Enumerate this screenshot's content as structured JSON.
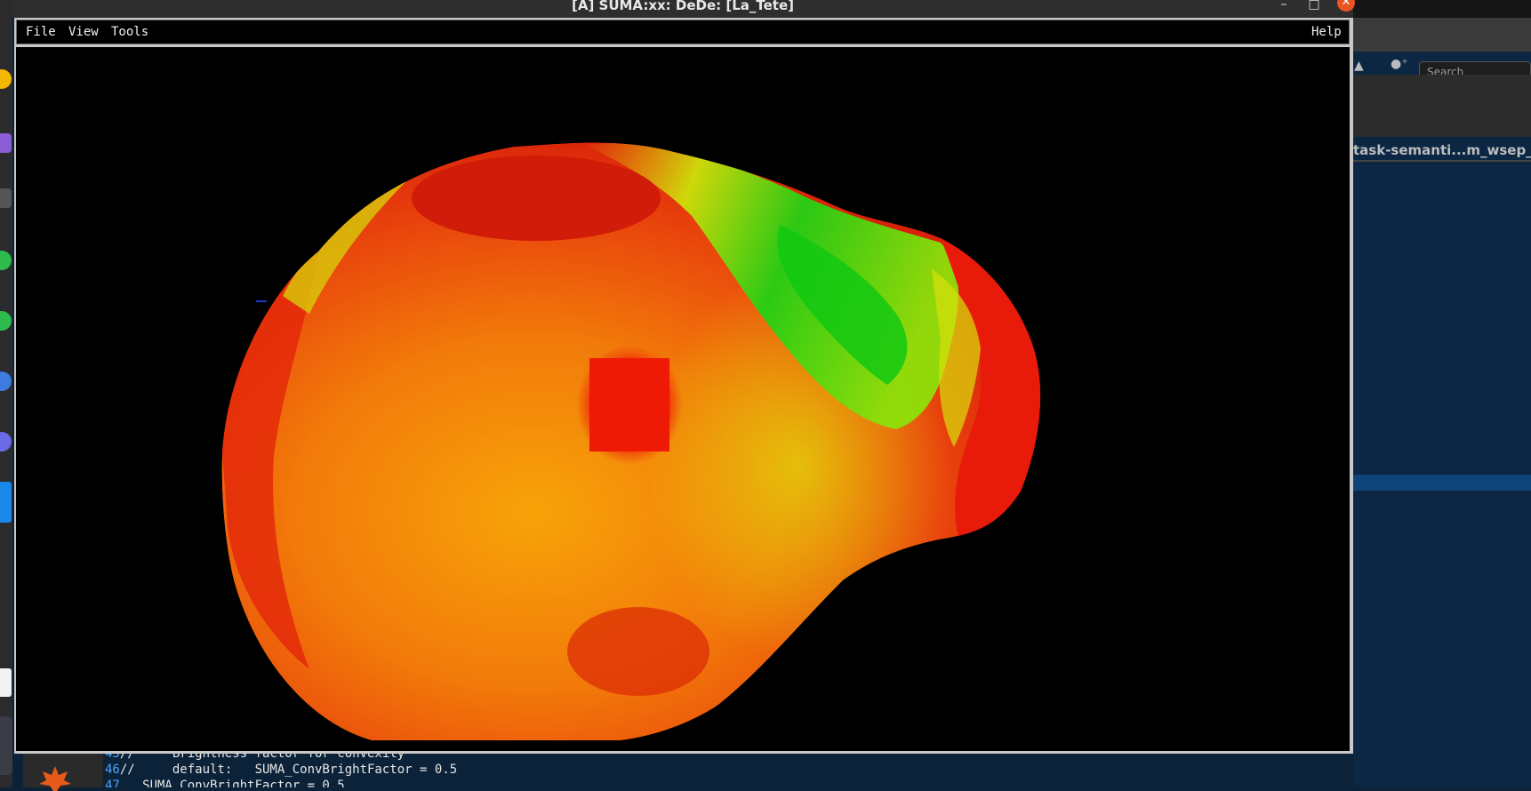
{
  "window": {
    "title": "[A] SUMA:xx: DeDe: [La_Tete]",
    "minimize_glyph": "–",
    "maximize_glyph": "□",
    "close_glyph": "✕"
  },
  "menubar": {
    "file": "File",
    "view": "View",
    "tools": "Tools",
    "help": "Help"
  },
  "viewer": {
    "background": "#000000",
    "surface_colors": [
      "#e01a0c",
      "#f06a0a",
      "#f5a00a",
      "#e6e60a",
      "#14cc14"
    ]
  },
  "background_app": {
    "search_placeholder": "Search",
    "tab_label": "task-semanti...m_wsep_deco"
  },
  "code_view": {
    "lines": [
      {
        "num": "45",
        "text": "//     Brightness factor for convexity"
      },
      {
        "num": "46",
        "text": "//     default:   SUMA_ConvBrightFactor = 0.5"
      },
      {
        "num": "47",
        "text": "   SUMA_ConvBrightFactor = 0.5"
      }
    ]
  },
  "icons": {
    "close": "close-icon",
    "minimize": "minimize-icon",
    "maximize": "maximize-icon",
    "dock": [
      "app-icon-yellow",
      "app-icon-purple",
      "app-icon-gray",
      "app-icon-green",
      "app-icon-green",
      "app-icon-blue",
      "app-icon-violet",
      "app-icon-blue-square",
      "app-icon-white"
    ]
  }
}
